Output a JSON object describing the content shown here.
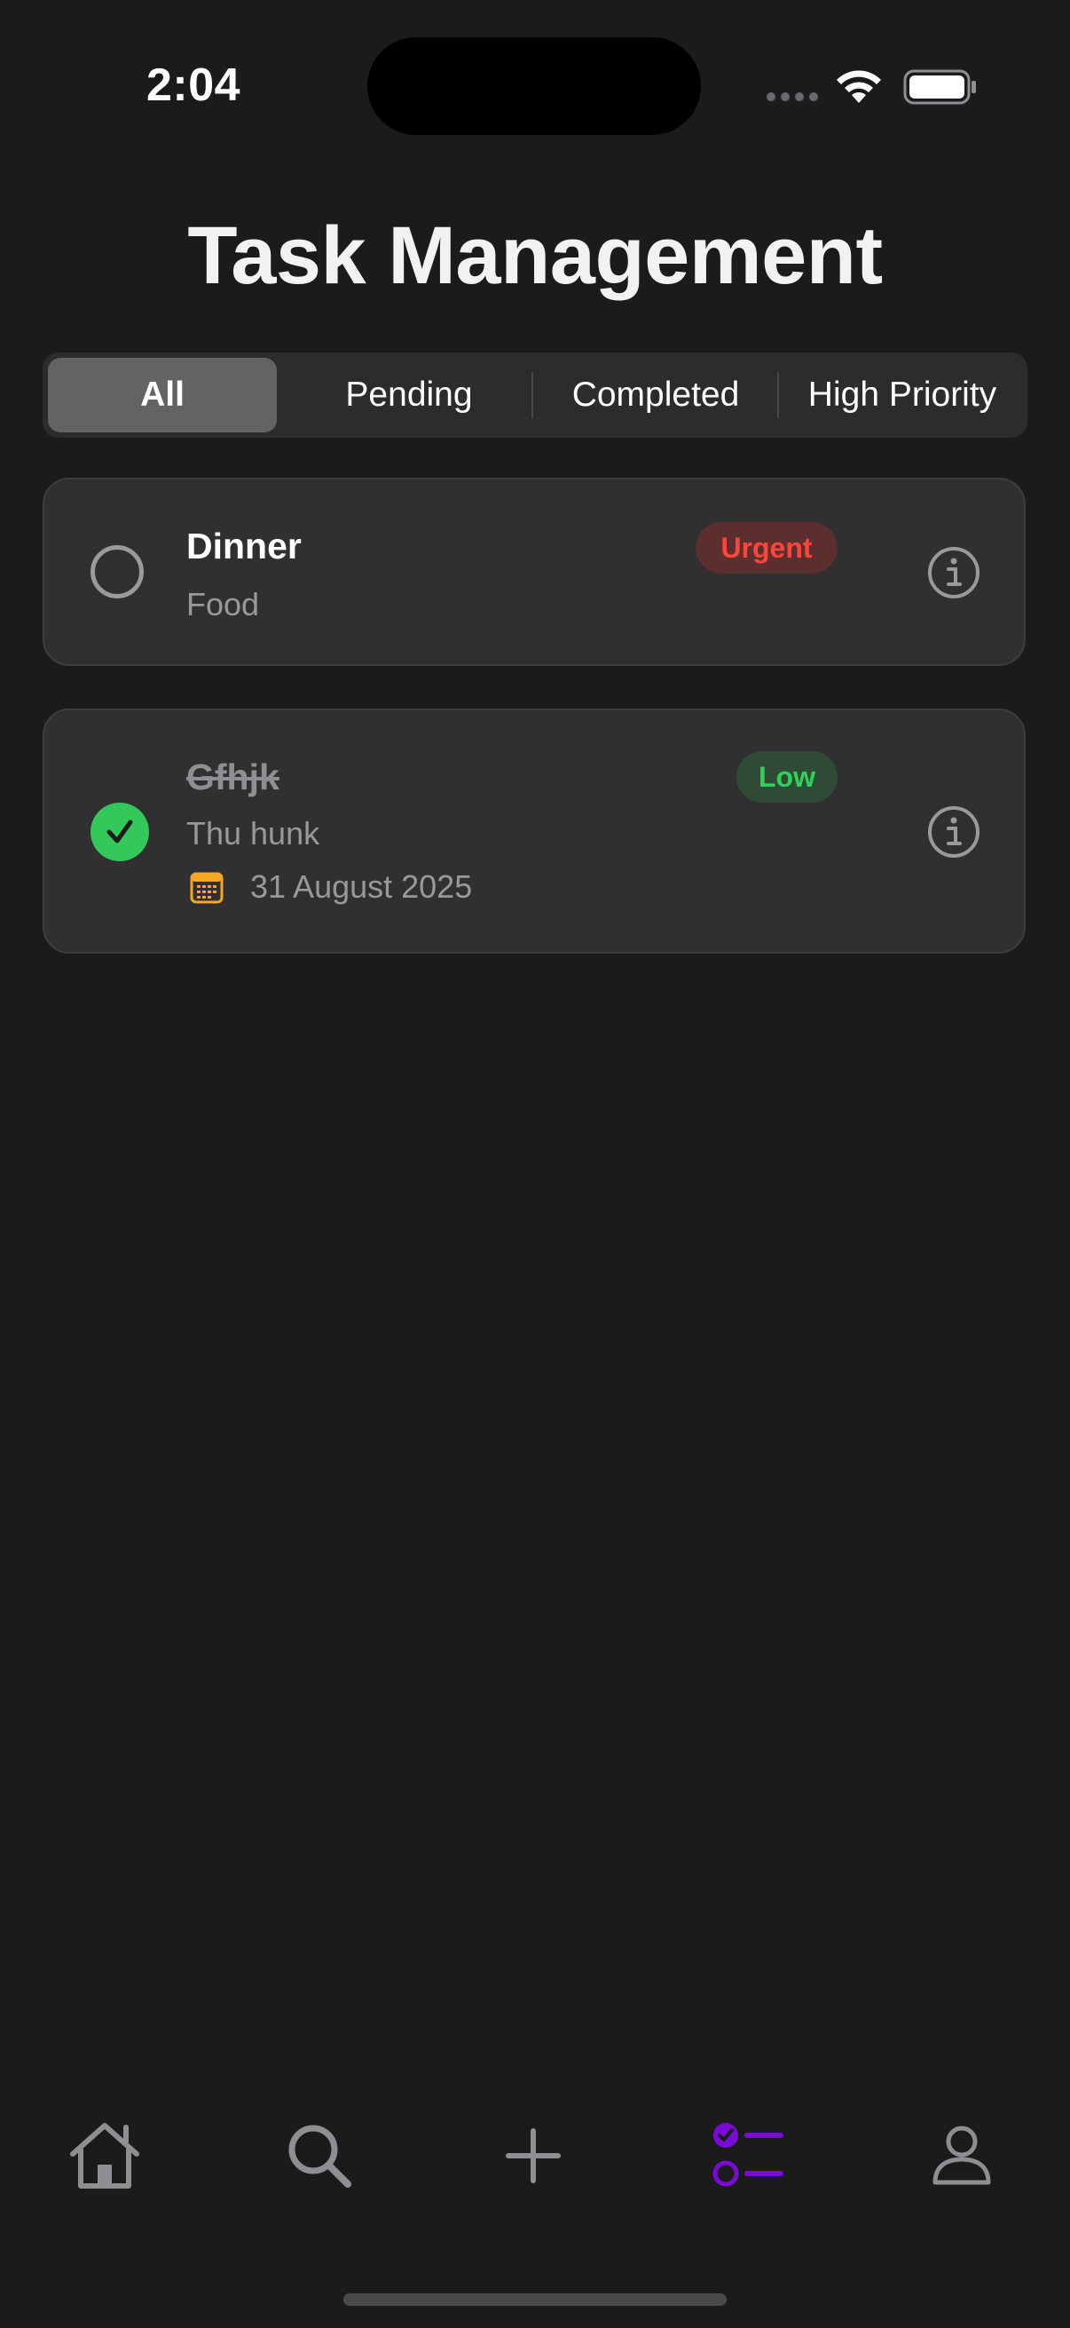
{
  "status_bar": {
    "time": "2:04"
  },
  "header": {
    "title": "Task Management"
  },
  "filters": {
    "segments": [
      {
        "label": "All",
        "selected": true
      },
      {
        "label": "Pending",
        "selected": false
      },
      {
        "label": "Completed",
        "selected": false
      },
      {
        "label": "High Priority",
        "selected": false
      }
    ]
  },
  "tasks": [
    {
      "title": "Dinner",
      "category": "Food",
      "priority": "Urgent",
      "completed": false,
      "date": ""
    },
    {
      "title": "Gfhjk",
      "category": "Thu hunk",
      "priority": "Low",
      "completed": true,
      "date": "31 August 2025"
    }
  ],
  "tab_bar": {
    "items": [
      {
        "icon": "home-icon",
        "active": false
      },
      {
        "icon": "search-icon",
        "active": false
      },
      {
        "icon": "plus-icon",
        "active": false
      },
      {
        "icon": "tasks-list-icon",
        "active": true
      },
      {
        "icon": "profile-icon",
        "active": false
      }
    ]
  },
  "colors": {
    "background": "#1b1b1c",
    "card": "#303032",
    "accent_active_tab": "#7a0bd6",
    "urgent": "#ff453a",
    "low": "#30d158",
    "completed_check": "#34c759",
    "calendar": "#f5a623"
  }
}
